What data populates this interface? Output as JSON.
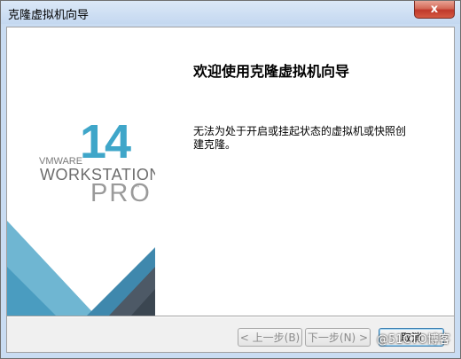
{
  "window": {
    "title": "克隆虚拟机向导",
    "close_label": "x"
  },
  "logo": {
    "version": "14",
    "brand": "VMWARE",
    "product": "WORKSTATION",
    "edition": "PRO",
    "trademark": "™",
    "colors": {
      "accent": "#3fa6c9",
      "dark_accent": "#5b9ab8",
      "gray": "#6d6d6d"
    }
  },
  "content": {
    "heading": "欢迎使用克隆虚拟机向导",
    "description": "无法为处于开启或挂起状态的虚拟机或快照创建克隆。"
  },
  "buttons": {
    "back": "< 上一步(B)",
    "next": "下一步(N) >",
    "cancel": "取消"
  },
  "watermark": "@51CTO博客"
}
